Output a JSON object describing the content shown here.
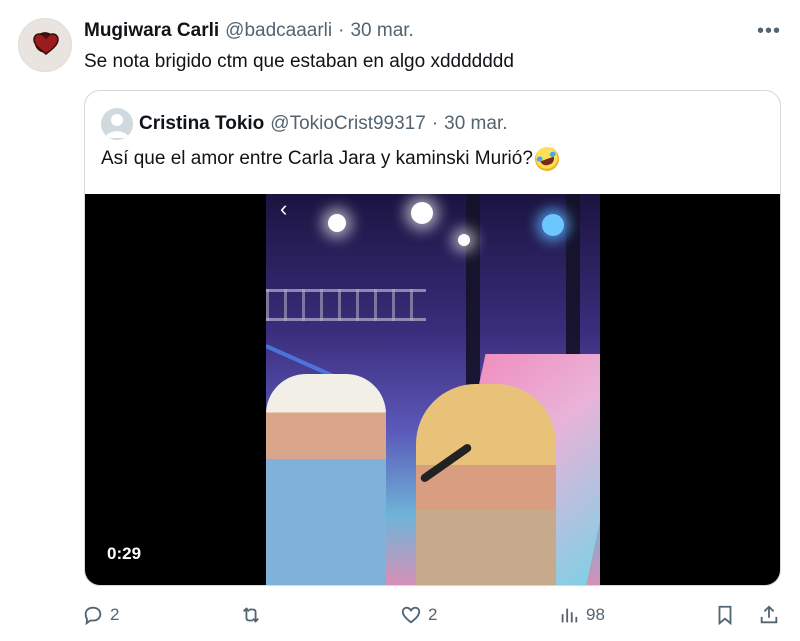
{
  "tweet": {
    "display_name": "Mugiwara Carli",
    "handle": "@badcaaarli",
    "separator": "·",
    "date": "30 mar.",
    "text": "Se nota brigido ctm que estaban en algo xddddddd",
    "more_label": "•••"
  },
  "quoted": {
    "display_name": "Cristina Tokio",
    "handle": "@TokioCrist99317",
    "separator": "·",
    "date": "30 mar.",
    "text": "Así que el amor entre Carla Jara y kaminski Murió?",
    "emoji": "rolling-on-floor-laughing"
  },
  "video": {
    "duration": "0:29",
    "back_glyph": "‹"
  },
  "actions": {
    "replies": "2",
    "retweets": "",
    "likes": "2",
    "views": "98"
  },
  "colors": {
    "text": "#0f1419",
    "muted": "#536471",
    "border": "#cfd9de"
  }
}
